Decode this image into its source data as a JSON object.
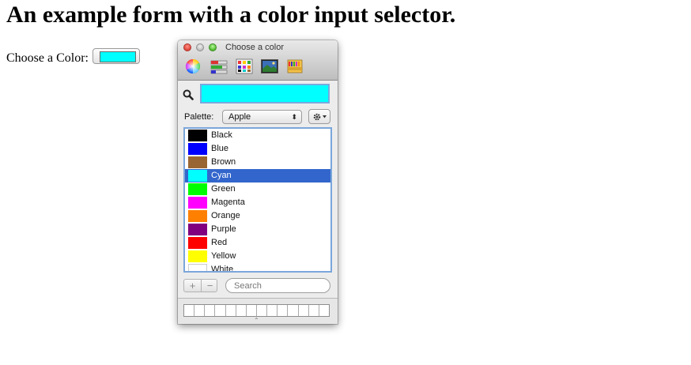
{
  "page": {
    "heading": "An example form with a color input selector.",
    "color_label": "Choose a Color:",
    "color_value": "#00ffff"
  },
  "panel": {
    "title": "Choose a color",
    "modes": [
      "color-wheel-icon",
      "color-sliders-icon",
      "color-palettes-icon",
      "image-palettes-icon",
      "crayons-icon"
    ],
    "hex_value": "#00ffff",
    "palette_label": "Palette:",
    "palette_selected": "Apple",
    "colors": [
      {
        "name": "Black",
        "hex": "#000000"
      },
      {
        "name": "Blue",
        "hex": "#0000ff"
      },
      {
        "name": "Brown",
        "hex": "#996633"
      },
      {
        "name": "Cyan",
        "hex": "#00ffff",
        "selected": true
      },
      {
        "name": "Green",
        "hex": "#00ff00"
      },
      {
        "name": "Magenta",
        "hex": "#ff00ff"
      },
      {
        "name": "Orange",
        "hex": "#ff8000"
      },
      {
        "name": "Purple",
        "hex": "#800080"
      },
      {
        "name": "Red",
        "hex": "#ff0000"
      },
      {
        "name": "Yellow",
        "hex": "#ffff00"
      },
      {
        "name": "White",
        "hex": "#ffffff"
      }
    ],
    "add_label": "+",
    "remove_label": "−",
    "search_placeholder": "Search",
    "resize_glyph": "⌃"
  }
}
